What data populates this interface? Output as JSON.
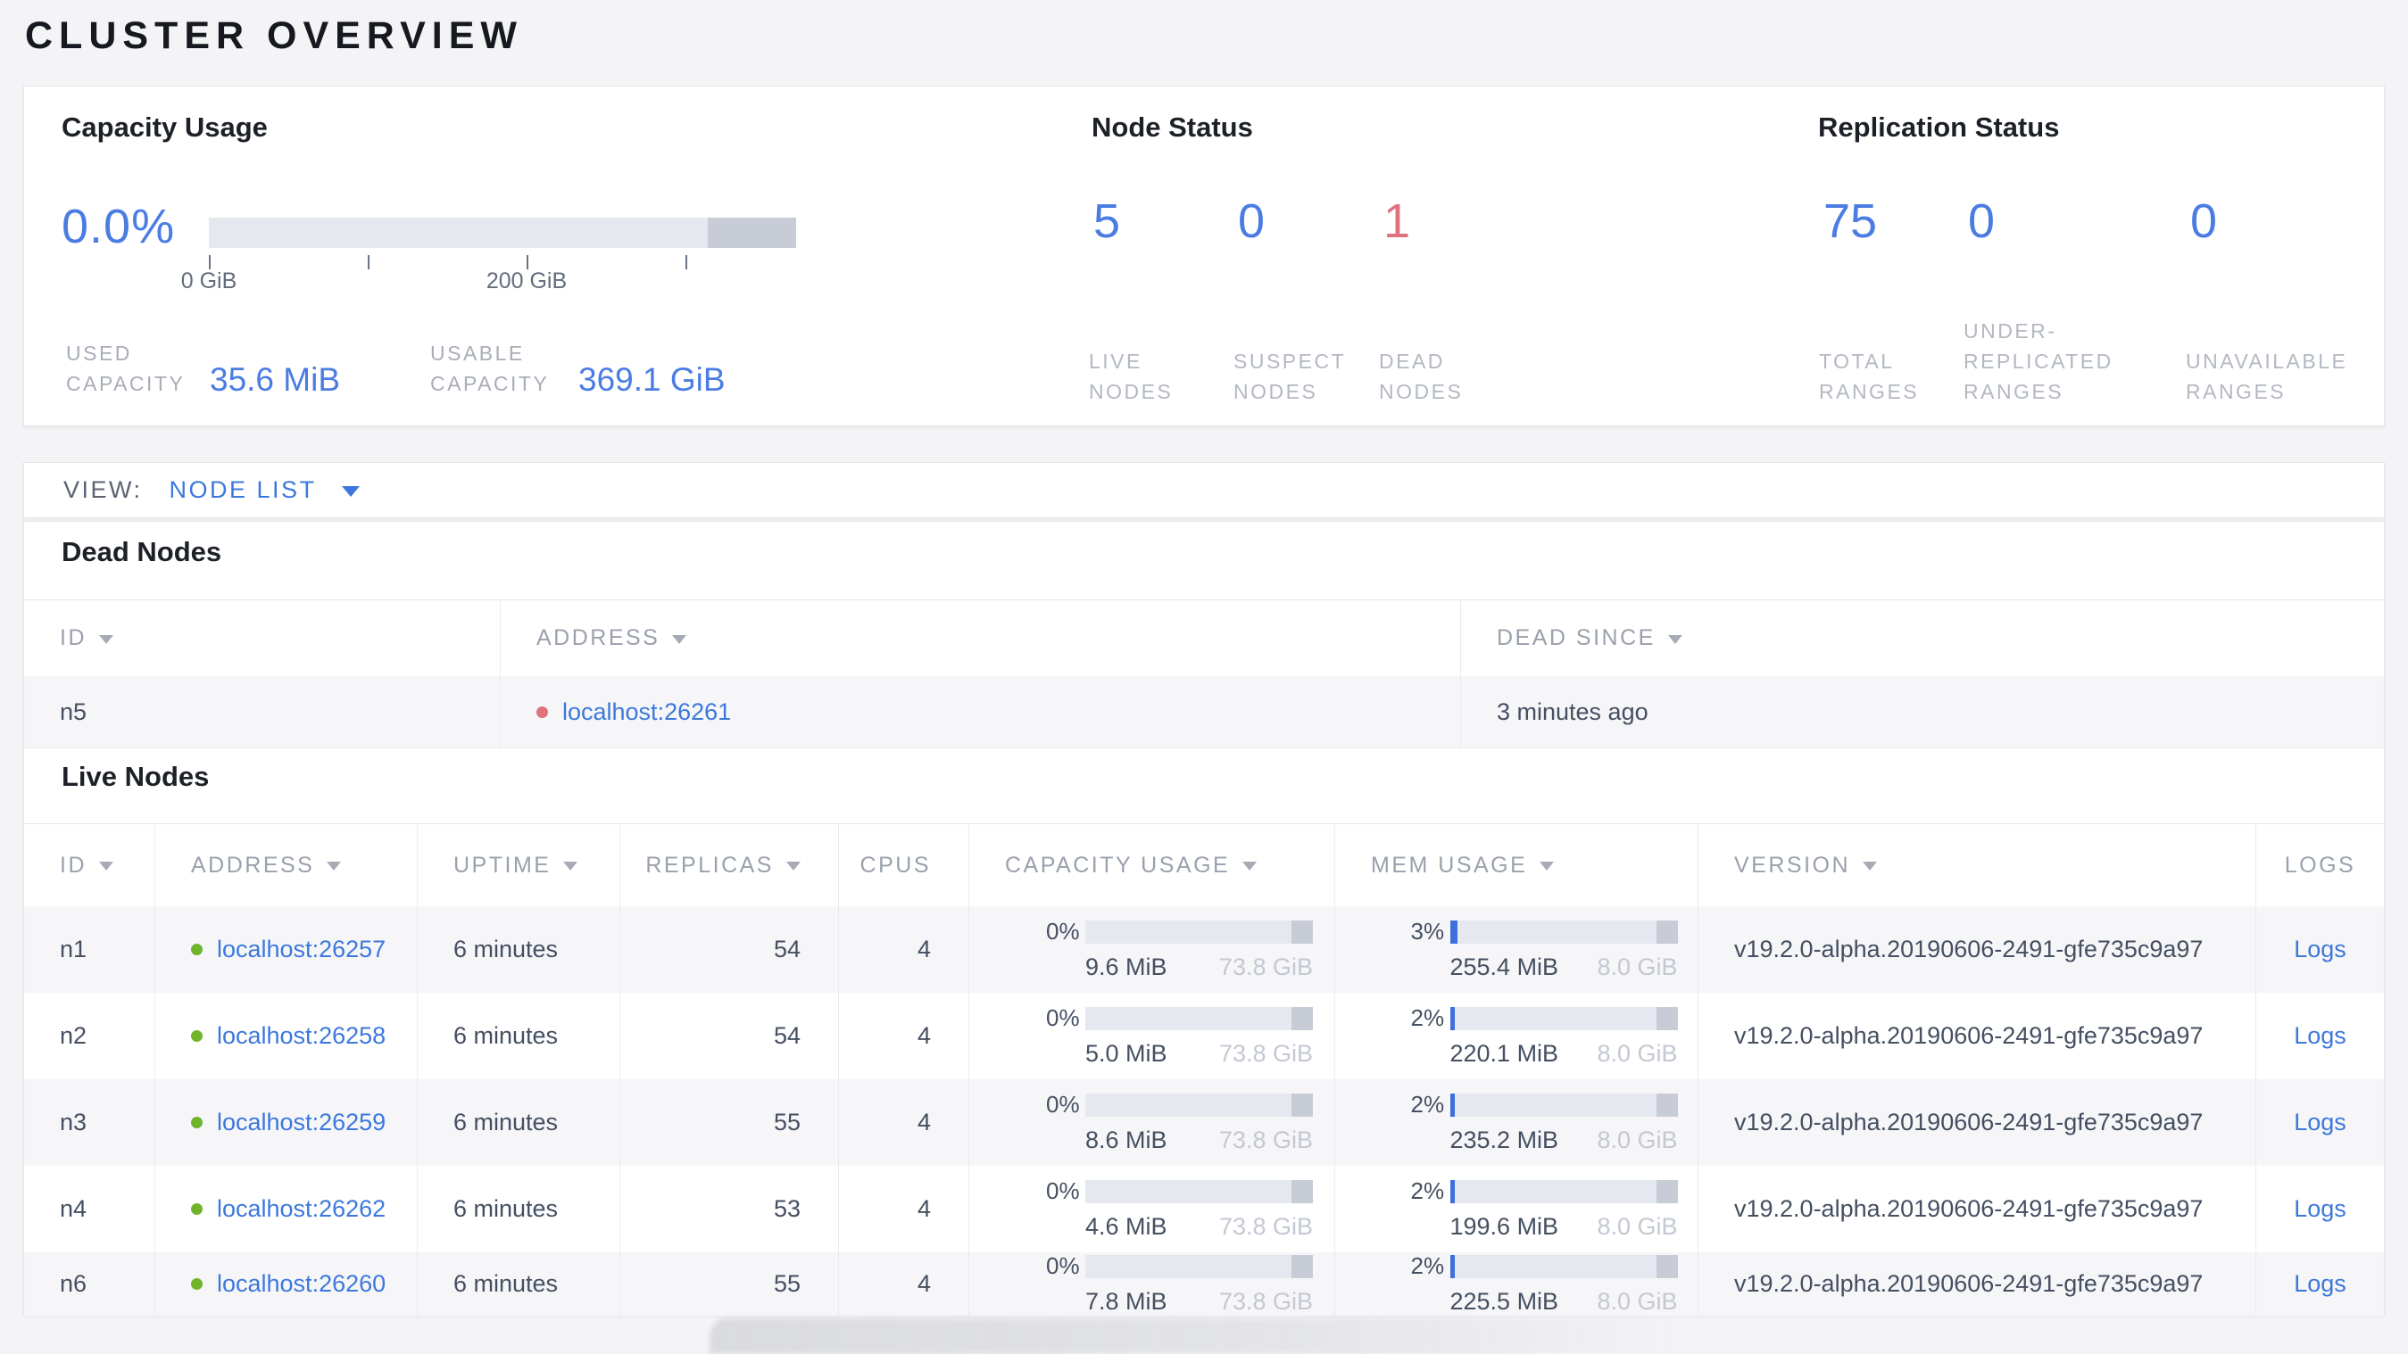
{
  "page": {
    "title": "CLUSTER OVERVIEW"
  },
  "summary": {
    "capacity": {
      "title": "Capacity Usage",
      "percent": "0.0%",
      "tick_labels": [
        "0 GiB",
        "200 GiB"
      ],
      "used": {
        "label_line1": "USED",
        "label_line2": "CAPACITY",
        "value": "35.6 MiB"
      },
      "usable": {
        "label_line1": "USABLE",
        "label_line2": "CAPACITY",
        "value": "369.1 GiB"
      }
    },
    "node_status": {
      "title": "Node Status",
      "live": {
        "value": "5",
        "label_line1": "LIVE",
        "label_line2": "NODES"
      },
      "suspect": {
        "value": "0",
        "label_line1": "SUSPECT",
        "label_line2": "NODES"
      },
      "dead": {
        "value": "1",
        "label_line1": "DEAD",
        "label_line2": "NODES"
      }
    },
    "replication": {
      "title": "Replication Status",
      "total": {
        "value": "75",
        "label_line1": "TOTAL",
        "label_line2": "RANGES"
      },
      "under_replicated": {
        "value": "0",
        "label_line1": "UNDER-",
        "label_line2": "REPLICATED",
        "label_line3": "RANGES"
      },
      "unavailable": {
        "value": "0",
        "label_line1": "UNAVAILABLE",
        "label_line2": "RANGES"
      }
    }
  },
  "view_bar": {
    "label": "VIEW:",
    "selected": "NODE LIST"
  },
  "dead_nodes": {
    "title": "Dead Nodes",
    "headers": {
      "id": "ID",
      "address": "ADDRESS",
      "dead_since": "DEAD SINCE"
    },
    "rows": [
      {
        "id": "n5",
        "address": "localhost:26261",
        "dead_since": "3 minutes ago"
      }
    ]
  },
  "live_nodes": {
    "title": "Live Nodes",
    "headers": {
      "id": "ID",
      "address": "ADDRESS",
      "uptime": "UPTIME",
      "replicas": "REPLICAS",
      "cpus": "CPUS",
      "capacity": "CAPACITY USAGE",
      "memory": "MEM USAGE",
      "version": "VERSION",
      "logs": "LOGS"
    },
    "rows": [
      {
        "id": "n1",
        "address": "localhost:26257",
        "uptime": "6 minutes",
        "replicas": "54",
        "cpus": "4",
        "capacity_pct": "0%",
        "capacity_used": "9.6 MiB",
        "capacity_total": "73.8 GiB",
        "mem_pct": "3%",
        "mem_used": "255.4 MiB",
        "mem_total": "8.0 GiB",
        "version": "v19.2.0-alpha.20190606-2491-gfe735c9a97",
        "logs_label": "Logs"
      },
      {
        "id": "n2",
        "address": "localhost:26258",
        "uptime": "6 minutes",
        "replicas": "54",
        "cpus": "4",
        "capacity_pct": "0%",
        "capacity_used": "5.0 MiB",
        "capacity_total": "73.8 GiB",
        "mem_pct": "2%",
        "mem_used": "220.1 MiB",
        "mem_total": "8.0 GiB",
        "version": "v19.2.0-alpha.20190606-2491-gfe735c9a97",
        "logs_label": "Logs"
      },
      {
        "id": "n3",
        "address": "localhost:26259",
        "uptime": "6 minutes",
        "replicas": "55",
        "cpus": "4",
        "capacity_pct": "0%",
        "capacity_used": "8.6 MiB",
        "capacity_total": "73.8 GiB",
        "mem_pct": "2%",
        "mem_used": "235.2 MiB",
        "mem_total": "8.0 GiB",
        "version": "v19.2.0-alpha.20190606-2491-gfe735c9a97",
        "logs_label": "Logs"
      },
      {
        "id": "n4",
        "address": "localhost:26262",
        "uptime": "6 minutes",
        "replicas": "53",
        "cpus": "4",
        "capacity_pct": "0%",
        "capacity_used": "4.6 MiB",
        "capacity_total": "73.8 GiB",
        "mem_pct": "2%",
        "mem_used": "199.6 MiB",
        "mem_total": "8.0 GiB",
        "version": "v19.2.0-alpha.20190606-2491-gfe735c9a97",
        "logs_label": "Logs"
      },
      {
        "id": "n6",
        "address": "localhost:26260",
        "uptime": "6 minutes",
        "replicas": "55",
        "cpus": "4",
        "capacity_pct": "0%",
        "capacity_used": "7.8 MiB",
        "capacity_total": "73.8 GiB",
        "mem_pct": "2%",
        "mem_used": "225.5 MiB",
        "mem_total": "8.0 GiB",
        "version": "v19.2.0-alpha.20190606-2491-gfe735c9a97",
        "logs_label": "Logs"
      }
    ]
  },
  "colors": {
    "accent_blue": "#3c78dc",
    "stat_blue": "#4a7ce2",
    "danger_red": "#df717f",
    "live_green": "#70b42c",
    "bar_track": "#e6e8ef",
    "bar_reserved": "#c7ccd6"
  }
}
